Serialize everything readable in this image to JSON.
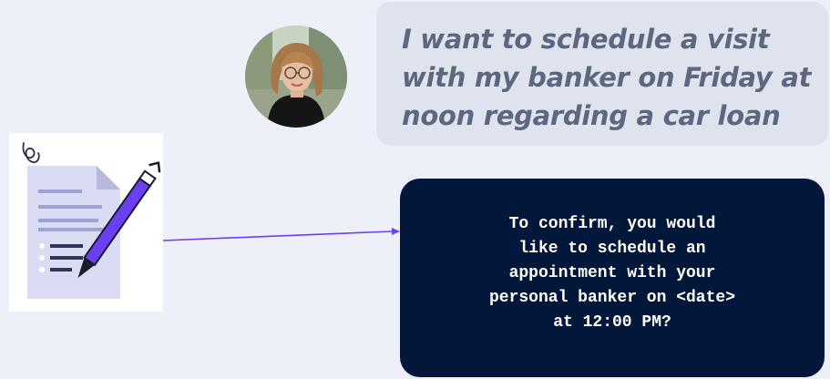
{
  "user_message": {
    "text": "I want to schedule a visit\nwith my banker on Friday at\nnoon regarding a car loan"
  },
  "assistant_message": {
    "text": "To confirm, you would\nlike to schedule an\nappointment with your\npersonal banker on <date>\nat 12:00 PM?"
  },
  "icons": {
    "avatar": "user-avatar-photo",
    "document": "document-with-pen-icon"
  },
  "colors": {
    "background": "#eef0f9",
    "user_bubble": "#dfe3ee",
    "user_text": "#5d677f",
    "assistant_bubble": "#03173a",
    "assistant_text": "#ffffff",
    "accent": "#6b3ff2"
  }
}
